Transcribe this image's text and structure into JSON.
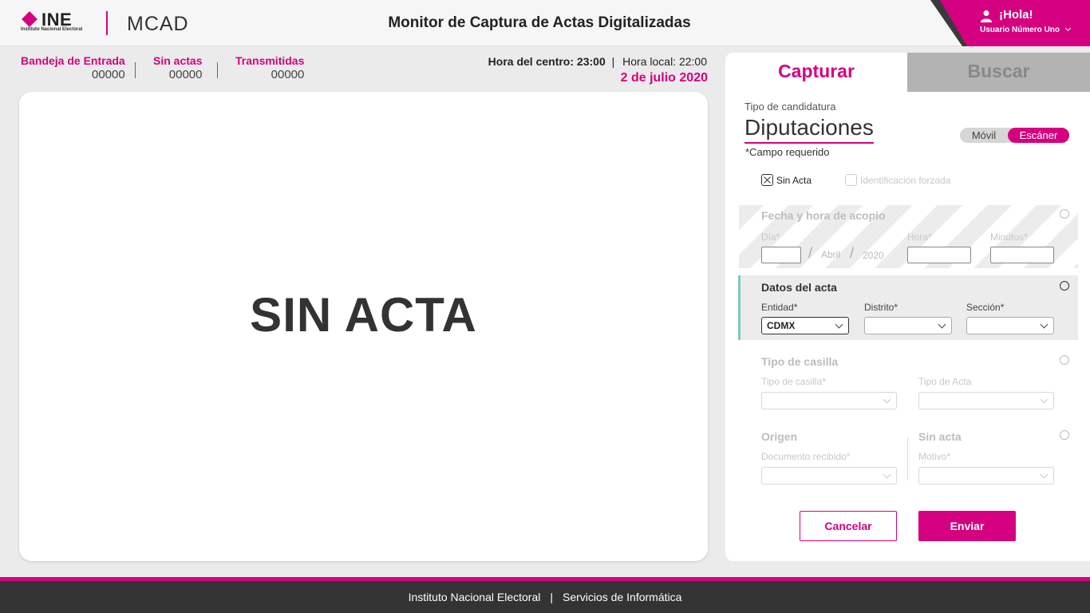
{
  "header": {
    "logo_text": "INE",
    "logo_sub": "Instituto Nacional Electoral",
    "app_name": "MCAD",
    "title": "Monitor de Captura de Actas Digitalizadas",
    "greeting": "¡Hola!",
    "user_name": "Usuario Número Uno"
  },
  "stats": [
    {
      "label": "Bandeja de Entrada",
      "value": "00000"
    },
    {
      "label": "Sin actas",
      "value": "00000"
    },
    {
      "label": "Transmitidas",
      "value": "00000"
    }
  ],
  "time": {
    "center_label": "Hora del centro:",
    "center_value": "23:00",
    "separator": "|",
    "local": "Hora local: 22:00",
    "date": "2 de julio 2020"
  },
  "main": {
    "message": "SIN ACTA"
  },
  "panel": {
    "tabs": [
      "Capturar",
      "Buscar"
    ],
    "tipo_label": "Tipo de candidatura",
    "tipo_value": "Diputaciones",
    "required_note": "*Campo requerido",
    "toggle": {
      "movil": "Móvil",
      "escaner": "Escáner"
    },
    "checkboxes": {
      "sin_acta": "Sin Acta",
      "identificacion": "Identificación forzada"
    },
    "fecha": {
      "title": "Fecha y hora de acopio",
      "dia_label": "Día*",
      "month": "Abril",
      "year": "2020",
      "hora_label": "Hora*",
      "minutos_label": "Minutos*"
    },
    "datos": {
      "title": "Datos del acta",
      "entidad_label": "Entidad*",
      "entidad_value": "CDMX",
      "distrito_label": "Distrito*",
      "seccion_label": "Sección*"
    },
    "casilla": {
      "title": "Tipo de casilla",
      "tipo_casilla_label": "Tipo de casilla*",
      "tipo_acta_label": "Tipo de Acta"
    },
    "origen": {
      "title": "Origen",
      "documento_label": "Documento recibido*",
      "sin_acta_title": "Sin acta",
      "motivo_label": "Motivo*"
    },
    "buttons": {
      "cancel": "Cancelar",
      "send": "Enviar"
    }
  },
  "footer": {
    "left": "Instituto Nacional Electoral",
    "separator": "|",
    "right": "Servicios de Informática"
  },
  "colors": {
    "accent": "#d5007f",
    "footer": "#333333",
    "active_section": "#7ec9c0"
  }
}
